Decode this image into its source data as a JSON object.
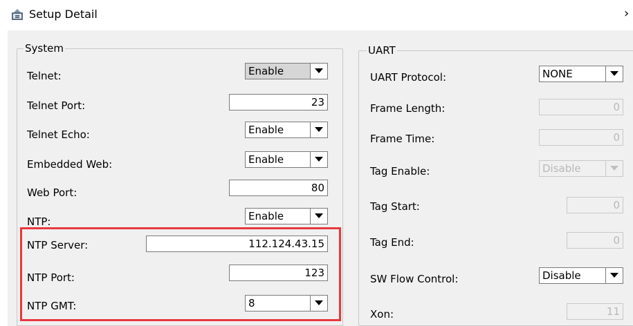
{
  "window": {
    "title": "Setup Detail"
  },
  "system": {
    "legend": "System",
    "telnet": {
      "label": "Telnet:",
      "value": "Enable"
    },
    "telnet_port": {
      "label": "Telnet Port:",
      "value": "23"
    },
    "telnet_echo": {
      "label": "Telnet Echo:",
      "value": "Enable"
    },
    "embedded_web": {
      "label": "Embedded Web:",
      "value": "Enable"
    },
    "web_port": {
      "label": "Web Port:",
      "value": "80"
    },
    "ntp": {
      "label": "NTP:",
      "value": "Enable"
    },
    "ntp_server": {
      "label": "NTP Server:",
      "value": "112.124.43.15"
    },
    "ntp_port": {
      "label": "NTP Port:",
      "value": "123"
    },
    "ntp_gmt": {
      "label": "NTP GMT:",
      "value": "8"
    }
  },
  "uart": {
    "legend": "UART",
    "protocol": {
      "label": "UART Protocol:",
      "value": "NONE"
    },
    "frame_length": {
      "label": "Frame Length:",
      "value": "0"
    },
    "frame_time": {
      "label": "Frame Time:",
      "value": "0"
    },
    "tag_enable": {
      "label": "Tag Enable:",
      "value": "Disable"
    },
    "tag_start": {
      "label": "Tag Start:",
      "value": "0"
    },
    "tag_end": {
      "label": "Tag End:",
      "value": "0"
    },
    "sw_flow_control": {
      "label": "SW Flow Control:",
      "value": "Disable"
    },
    "xon": {
      "label": "Xon:",
      "value": "11"
    }
  },
  "icons": {
    "app": "settings-window-icon",
    "close": "close-icon",
    "dropdown": "chevron-down-icon"
  },
  "colors": {
    "highlight": "#e8383d",
    "window_bg": "#f0f0f0",
    "disabled_text": "#b8b8b8"
  }
}
